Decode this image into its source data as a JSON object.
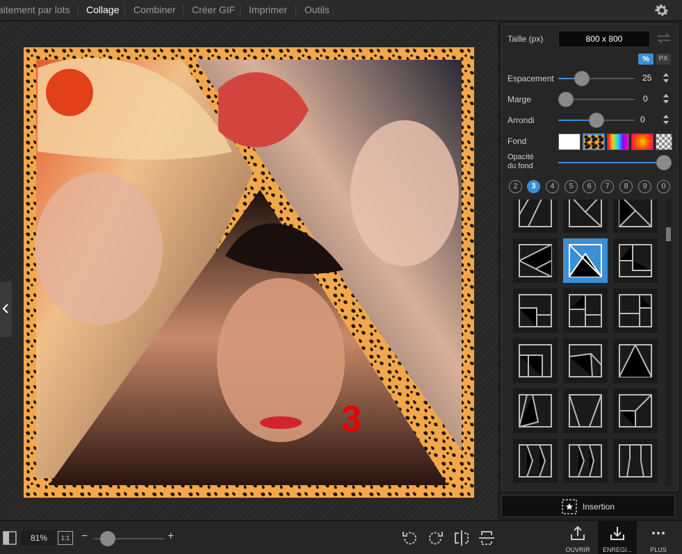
{
  "menu": {
    "items": [
      {
        "label": "aitement par lots",
        "active": false
      },
      {
        "label": "Collage",
        "active": true
      },
      {
        "label": "Combiner",
        "active": false
      },
      {
        "label": "Créer GIF",
        "active": false
      },
      {
        "label": "Imprimer",
        "active": false
      },
      {
        "label": "Outils",
        "active": false
      }
    ]
  },
  "collage": {
    "number_label": "3",
    "frame_color": "#f2a84a"
  },
  "panel": {
    "size_label": "Taille (px)",
    "size_value": "800 x 800",
    "unit_percent": "%",
    "unit_px": "PX",
    "spacing_label": "Espacement",
    "spacing_value": "25",
    "margin_label": "Marge",
    "margin_value": "0",
    "rounding_label": "Arrondi",
    "rounding_value": "0",
    "background_label": "Fond",
    "opacity_label_line1": "Opacité",
    "opacity_label_line2": "du fond",
    "photo_counts": [
      "2",
      "3",
      "4",
      "5",
      "6",
      "7",
      "8",
      "9",
      "0"
    ],
    "selected_count": "3",
    "accent_color": "#3b8fd6",
    "selected_background": "leopard"
  },
  "insert_button": {
    "label": "Insertion"
  },
  "bottom": {
    "zoom_value": "81%",
    "one_to_one": "1:1",
    "actions": {
      "open_label": "OUVRIR",
      "save_label": "ENREGI...",
      "more_label": "PLUS"
    }
  }
}
